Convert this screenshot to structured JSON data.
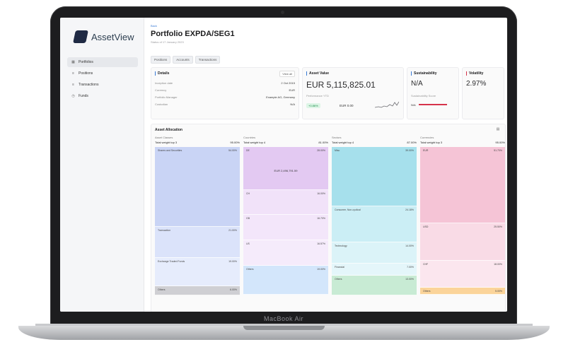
{
  "device": {
    "label": "MacBook Air"
  },
  "app": {
    "name": "AssetView"
  },
  "sidebar": {
    "items": [
      {
        "label": "Portfolios",
        "icon": "grid-icon",
        "active": true
      },
      {
        "label": "Positions",
        "icon": "list-icon",
        "active": false
      },
      {
        "label": "Transactions",
        "icon": "list-icon",
        "active": false
      },
      {
        "label": "Funds",
        "icon": "clock-icon",
        "active": false
      }
    ]
  },
  "header": {
    "back_label": "Back",
    "title": "Portfolio EXPDA/SEG1",
    "subtitle": "Status of 17 January 2023"
  },
  "tabs": [
    "Positions",
    "Accounts",
    "Transactions"
  ],
  "details": {
    "title": "Details",
    "view_all": "View all",
    "rows": [
      {
        "label": "Inception date",
        "value": "2 Oct 2015"
      },
      {
        "label": "Currency",
        "value": "EUR"
      },
      {
        "label": "Portfolio Manager",
        "value": "Example AG, Germany"
      },
      {
        "label": "Custodian",
        "value": "N/A"
      }
    ]
  },
  "asset_value": {
    "title": "Asset Value",
    "value": "EUR 5,115,825.01",
    "performance_label": "Performance YTD",
    "change": "+0.86%",
    "change_abs": "EUR 0.00"
  },
  "sustainability": {
    "title": "Sustainability",
    "value": "N/A",
    "score_label": "Sustainability Score",
    "score_value": "N/A"
  },
  "volatility": {
    "title": "Volatility",
    "value": "2.97%"
  },
  "allocation": {
    "title": "Asset Allocation",
    "columns": [
      {
        "name": "Asset Classes",
        "total_label": "Total weight top 3",
        "total_value": "95.00%",
        "items": [
          {
            "label": "Shares and Securities",
            "value": "54.00%",
            "color": "#c9d4f5",
            "weight": 54
          },
          {
            "label": "Transaction",
            "value": "21.00%",
            "color": "#dbe3fa",
            "weight": 21
          },
          {
            "label": "Exchange Traded Funds",
            "value": "19.00%",
            "color": "#e6ecfc",
            "weight": 19
          },
          {
            "label": "Others",
            "value": "6.00%",
            "color": "#cfcfd3",
            "weight": 6
          }
        ]
      },
      {
        "name": "Countries",
        "total_label": "Total weight top 4",
        "total_value": "81.00%",
        "highlight": "EUR 2,496,791.59",
        "items": [
          {
            "label": "DE",
            "value": "28.00%",
            "color": "#e3c9f2",
            "weight": 28
          },
          {
            "label": "CH",
            "value": "16.00%",
            "color": "#f1e2f9",
            "weight": 16
          },
          {
            "label": "GB",
            "value": "16.70%",
            "color": "#f3e6fa",
            "weight": 16.7
          },
          {
            "label": "US",
            "value": "16.57%",
            "color": "#f5ebfb",
            "weight": 16.57
          },
          {
            "label": "Others",
            "value": "19.00%",
            "color": "#d3e6fb",
            "weight": 19
          }
        ]
      },
      {
        "name": "Sectors",
        "total_label": "Total weight top 4",
        "total_value": "87.00%",
        "items": [
          {
            "label": "Misc",
            "value": "39.00%",
            "color": "#a6e0ec",
            "weight": 39
          },
          {
            "label": "Consumer, Non-cyclical",
            "value": "24.18%",
            "color": "#cbeef5",
            "weight": 24
          },
          {
            "label": "Technology",
            "value": "14.00%",
            "color": "#dbf3f8",
            "weight": 14
          },
          {
            "label": "Financial",
            "value": "7.00%",
            "color": "#e4f6fa",
            "weight": 8
          },
          {
            "label": "Others",
            "value": "13.00%",
            "color": "#c8ebd4",
            "weight": 13
          }
        ]
      },
      {
        "name": "Currencies",
        "total_label": "Total weight top 3",
        "total_value": "95.00%",
        "items": [
          {
            "label": "EUR",
            "value": "51.70%",
            "color": "#f5c4d6",
            "weight": 51.7
          },
          {
            "label": "USD",
            "value": "25.50%",
            "color": "#f9dbe6",
            "weight": 25.5
          },
          {
            "label": "CHF",
            "value": "18.00%",
            "color": "#fbe6ee",
            "weight": 18
          },
          {
            "label": "Others",
            "value": "5.00%",
            "color": "#fbd49a",
            "weight": 5
          }
        ]
      }
    ]
  }
}
